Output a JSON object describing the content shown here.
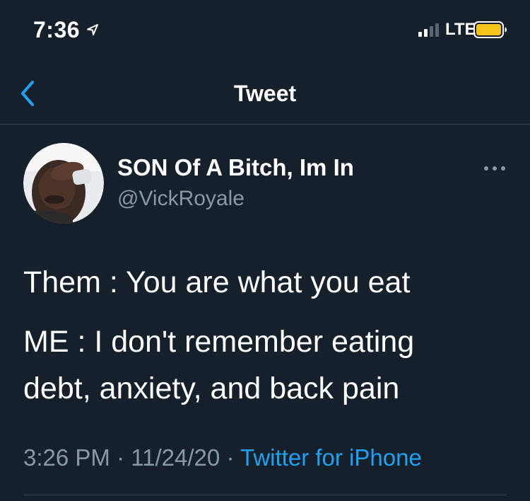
{
  "status_bar": {
    "time": "7:36",
    "network": "LTE",
    "icons": [
      "location-arrow-icon",
      "cellular-signal-icon",
      "battery-icon"
    ],
    "battery_color": "#f5c518"
  },
  "header": {
    "title": "Tweet",
    "back_icon": "chevron-left-icon"
  },
  "tweet": {
    "display_name": "SON Of A Bitch, Im In",
    "username": "@VickRoyale",
    "more_icon": "more-horizontal-icon",
    "lines": [
      "Them : You are what you eat",
      "ME : I don't remember eating",
      "debt, anxiety, and back pain"
    ],
    "time": "3:26 PM",
    "date": "11/24/20",
    "separator": "·",
    "source": "Twitter for iPhone"
  },
  "colors": {
    "background": "#15202b",
    "text_primary": "#ffffff",
    "text_secondary": "#8899a6",
    "accent": "#1da1f2",
    "divider": "#38444d"
  }
}
